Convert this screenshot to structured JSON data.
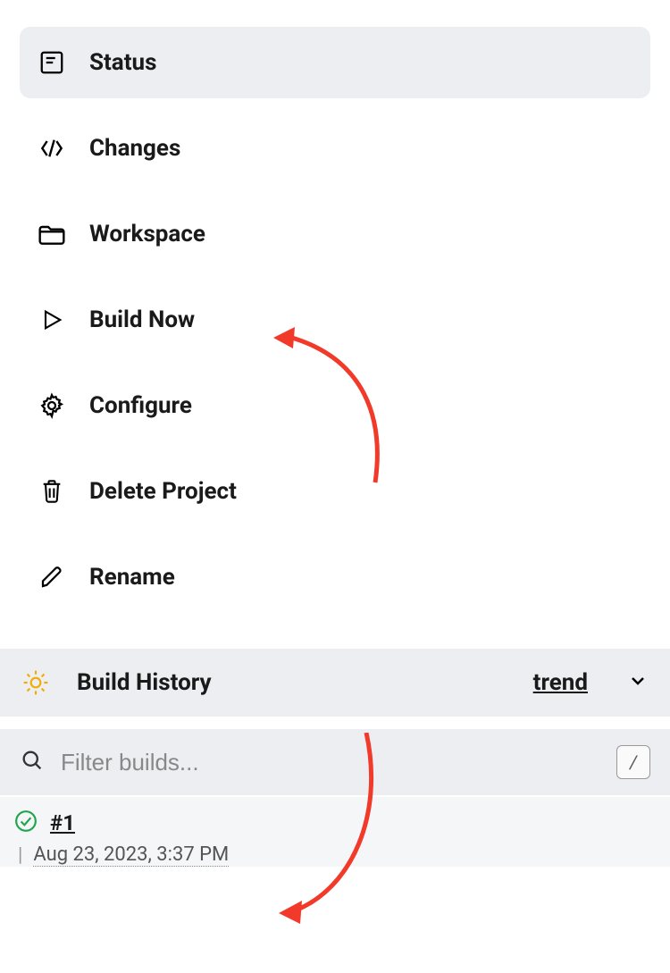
{
  "sidebar": {
    "items": [
      {
        "label": "Status",
        "icon": "status-icon",
        "active": true
      },
      {
        "label": "Changes",
        "icon": "changes-icon",
        "active": false
      },
      {
        "label": "Workspace",
        "icon": "workspace-icon",
        "active": false
      },
      {
        "label": "Build Now",
        "icon": "build-now-icon",
        "active": false
      },
      {
        "label": "Configure",
        "icon": "configure-icon",
        "active": false
      },
      {
        "label": "Delete Project",
        "icon": "delete-icon",
        "active": false
      },
      {
        "label": "Rename",
        "icon": "rename-icon",
        "active": false
      }
    ]
  },
  "build_history": {
    "title": "Build History",
    "trend_label": "trend",
    "filter_placeholder": "Filter builds...",
    "shortcut_hint": "/",
    "builds": [
      {
        "id": "#1",
        "timestamp": "Aug 23, 2023, 3:37 PM",
        "status": "success"
      }
    ]
  },
  "colors": {
    "accent_orange": "#f0ad00",
    "success_green": "#1ea64b",
    "annotation_red": "#f13a2a"
  }
}
